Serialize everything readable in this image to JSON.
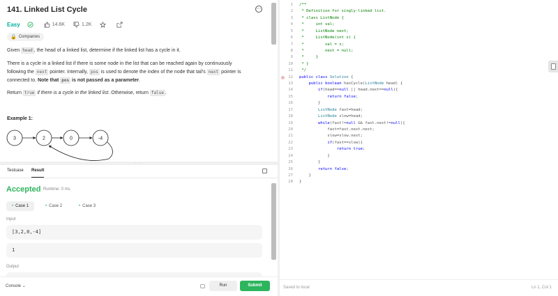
{
  "problem": {
    "title": "141. Linked List Cycle",
    "difficulty": "Easy",
    "likes": "14.6K",
    "dislikes": "1.2K",
    "companies_label": "Companies",
    "p1": {
      "a": "Given ",
      "b": "head",
      "c": ", the head of a linked list, determine if the linked list has a cycle in it."
    },
    "p2": {
      "a": "There is a cycle in a linked list if there is some node in the list that can be reached again by continuously",
      "b": "following the ",
      "c": "next",
      "d": " pointer. Internally, ",
      "e": "pos",
      "f": " is used to denote the index of the node that tail's ",
      "g": "next",
      "h": " pointer is",
      "i": "connected to. ",
      "j": "Note that ",
      "k": "pos",
      "l": " is not passed as a parameter",
      "m": "."
    },
    "p3": {
      "a": "Return ",
      "b": "true",
      "c": " if there is a cycle in the linked list",
      "d": ". Otherwise, return ",
      "e": "false",
      "f": "."
    },
    "example_title": "Example 1:",
    "nodes": [
      "3",
      "2",
      "0",
      "-4"
    ]
  },
  "tests": {
    "tab_testcase": "Testcase",
    "tab_result": "Result",
    "status": "Accepted",
    "runtime": "Runtime: 0 ms",
    "cases": [
      "Case 1",
      "Case 2",
      "Case 3"
    ],
    "input_label": "Input",
    "input_head": "[3,2,0,-4]",
    "input_pos": "1",
    "output_label": "Output"
  },
  "footer": {
    "console": "Console",
    "run": "Run",
    "submit": "Submit"
  },
  "editor": {
    "lines": [
      "/**",
      " * Definition for singly-linked list.",
      " * class ListNode {",
      " *     int val;",
      " *     ListNode next;",
      " *     ListNode(int x) {",
      " *         val = x;",
      " *         next = null;",
      " *     }",
      " * }",
      " */",
      "public class Solution {",
      "    public boolean hasCycle(ListNode head) {",
      "        if(head==null || head.next==null){",
      "            return false;",
      "        }",
      "        ListNode fast=head;",
      "        ListNode slow=head;",
      "        while(fast!=null && fast.next!=null){",
      "            fast=fast.next.next;",
      "            slow=slow.next;",
      "            if(fast==slow){",
      "                return true;",
      "            }",
      "        }",
      "        return false;",
      "    }",
      "}"
    ],
    "saved": "Saved to local",
    "cursor": "Ln 1, Col 1"
  },
  "colors": {
    "accent": "#2db55d",
    "easy": "#00af9b",
    "comment": "#008000",
    "keyword": "#0000ff",
    "type": "#267f99"
  }
}
